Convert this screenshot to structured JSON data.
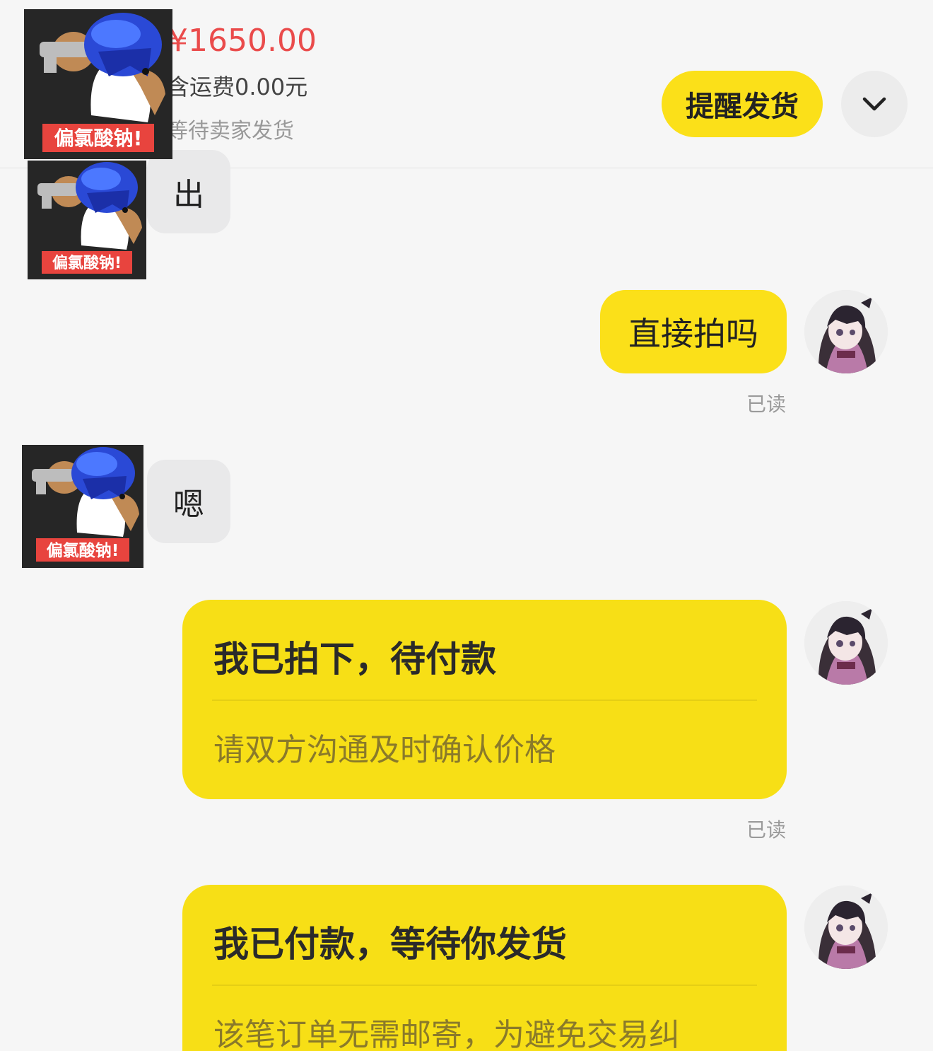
{
  "order": {
    "price": "¥1650.00",
    "shipping": "含运费0.00元",
    "status": "等待卖家发货",
    "remind_label": "提醒发货",
    "more_icon": "chevron-down-icon"
  },
  "sticker": {
    "caption": "偏氯酸钠!"
  },
  "messages": {
    "m1": {
      "text": "出"
    },
    "m2": {
      "text": "直接拍吗",
      "read": "已读"
    },
    "m3": {
      "text": "嗯"
    },
    "m4": {
      "title": "我已拍下，待付款",
      "subtitle": "请双方沟通及时确认价格",
      "read": "已读"
    },
    "m5": {
      "title": "我已付款，等待你发货",
      "subtitle": "该笔订单无需邮寄，为避免交易纠"
    }
  },
  "colors": {
    "accent_yellow": "#fbe019",
    "price_red": "#ea4b4b",
    "incoming_bubble": "#e9e9ea"
  }
}
